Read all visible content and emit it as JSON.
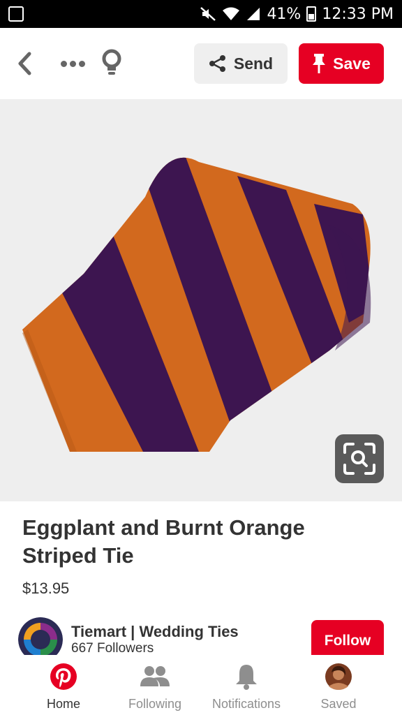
{
  "status_bar": {
    "battery": "41%",
    "time": "12:33 PM"
  },
  "header": {
    "send_label": "Send",
    "save_label": "Save"
  },
  "pin": {
    "image_subject": "tie-image",
    "title": "Eggplant and Burnt Orange Striped Tie",
    "price": "$13.95"
  },
  "creator": {
    "name": "Tiemart | Wedding Ties",
    "followers": "667 Followers",
    "follow_label": "Follow"
  },
  "bottom_nav": [
    {
      "label": "Home",
      "icon": "pinterest-icon",
      "active": true
    },
    {
      "label": "Following",
      "icon": "people-icon",
      "active": false
    },
    {
      "label": "Notifications",
      "icon": "bell-icon",
      "active": false
    },
    {
      "label": "Saved",
      "icon": "profile-avatar-icon",
      "active": false
    }
  ],
  "colors": {
    "brand_red": "#e60023",
    "tie_orange": "#d2691e",
    "tie_purple": "#3d1550"
  }
}
